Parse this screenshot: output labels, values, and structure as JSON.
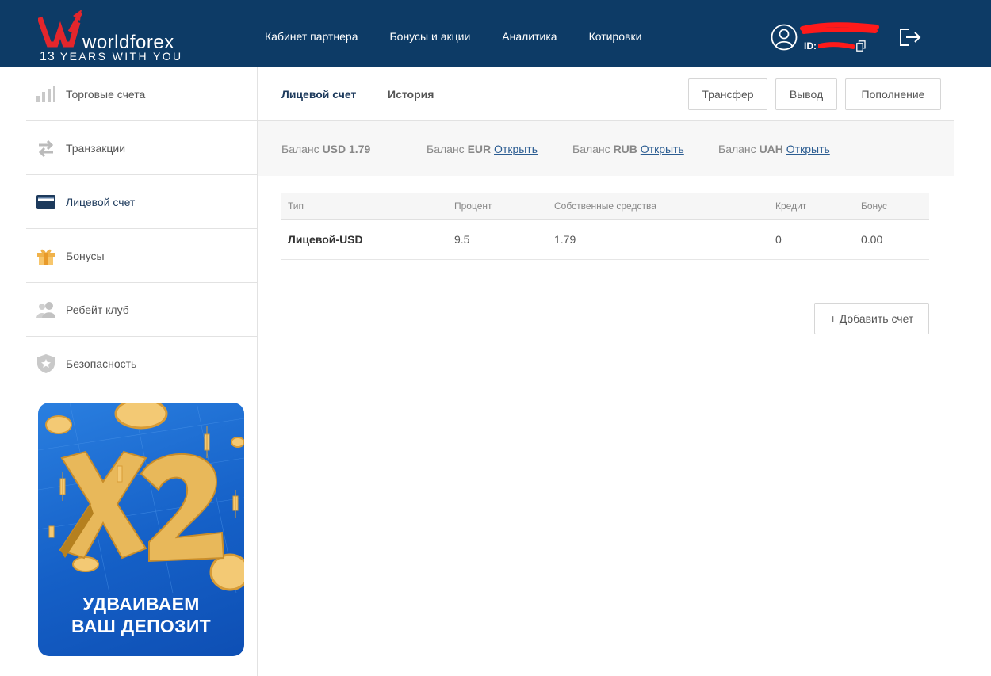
{
  "header": {
    "logo_name": "worldforex",
    "logo_years": "13",
    "logo_tagline": "YEARS WITH YOU",
    "nav": [
      "Кабинет партнера",
      "Бонусы и акции",
      "Аналитика",
      "Котировки"
    ],
    "user_id_label": "ID:"
  },
  "sidebar": {
    "items": [
      {
        "label": "Торговые счета",
        "icon": "bar-chart-icon"
      },
      {
        "label": "Транзакции",
        "icon": "arrows-exchange-icon"
      },
      {
        "label": "Лицевой счет",
        "icon": "wallet-icon"
      },
      {
        "label": "Бонусы",
        "icon": "gift-icon"
      },
      {
        "label": "Ребейт клуб",
        "icon": "users-icon"
      },
      {
        "label": "Безопасность",
        "icon": "shield-icon"
      }
    ],
    "promo_line1": "УДВАИВАЕМ",
    "promo_line2": "ВАШ ДЕПОЗИТ"
  },
  "tabs": [
    {
      "label": "Лицевой счет",
      "active": true
    },
    {
      "label": "История",
      "active": false
    }
  ],
  "actions": {
    "transfer": "Трансфер",
    "withdraw": "Вывод",
    "deposit": "Пополнение"
  },
  "balances": [
    {
      "label": "Баланс",
      "currency": "USD",
      "value": "1.79"
    },
    {
      "label": "Баланс",
      "currency": "EUR",
      "link": "Открыть"
    },
    {
      "label": "Баланс",
      "currency": "RUB",
      "link": "Открыть"
    },
    {
      "label": "Баланс",
      "currency": "UAH",
      "link": "Открыть"
    }
  ],
  "table": {
    "headers": [
      "Тип",
      "Процент",
      "Собственные средства",
      "Кредит",
      "Бонус"
    ],
    "rows": [
      [
        "Лицевой-USD",
        "9.5",
        "1.79",
        "0",
        "0.00"
      ]
    ]
  },
  "add_account": "+ Добавить счет",
  "colors": {
    "header_bg": "#0d3b66",
    "logo_red": "#e3262c",
    "accent_link": "#2c5d92",
    "active_text": "#1d3a5c",
    "redaction": "#ff1a1a"
  }
}
